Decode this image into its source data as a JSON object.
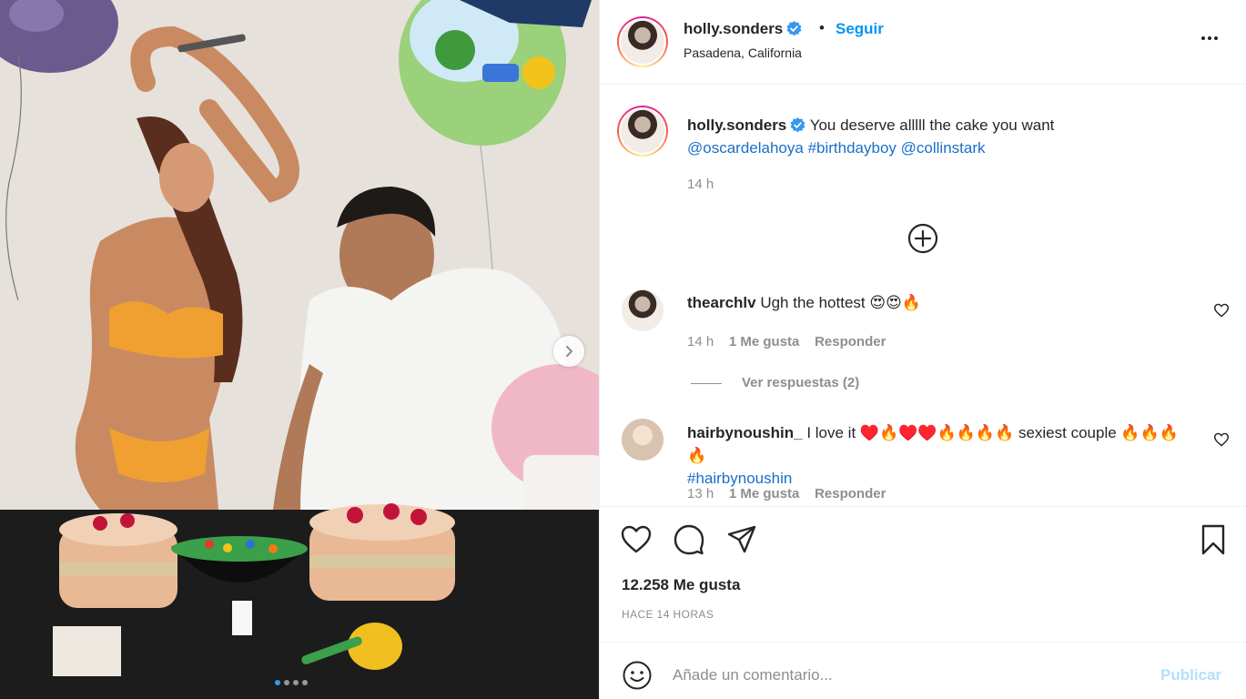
{
  "post": {
    "image_alt": "",
    "carousel": {
      "total": 4,
      "active_index": 0
    }
  },
  "header": {
    "username": "holly.sonders",
    "separator": "•",
    "follow_label": "Seguir",
    "location": "Pasadena, California",
    "more_icon": "ellipsis-icon"
  },
  "caption": {
    "username": "holly.sonders",
    "text": "You deserve alllll the cake you want",
    "tags": [
      "@oscardelahoya",
      "#birthdayboy",
      "@collinstark"
    ],
    "time": "14 h"
  },
  "comments": [
    {
      "username": "thearchlv",
      "text": "Ugh the hottest 😍😍🔥",
      "time": "14 h",
      "likes": "1 Me gusta",
      "reply_label": "Responder",
      "view_replies": "Ver respuestas (2)"
    },
    {
      "username": "hairbynoushin_",
      "text": "I love it ♥️🔥♥️♥️🔥🔥🔥🔥 sexiest couple 🔥🔥🔥🔥",
      "hashtag": "#hairbynoushin",
      "time": "13 h",
      "likes": "1 Me gusta",
      "reply_label": "Responder"
    }
  ],
  "actions": {
    "likes_count": "12.258 Me gusta",
    "time_ago": "HACE 14 HORAS"
  },
  "composer": {
    "placeholder": "Añade un comentario...",
    "publish_label": "Publicar"
  },
  "colors": {
    "link": "#1a6fc9",
    "follow": "#0095f6",
    "publish_disabled": "#b2dffc",
    "muted": "#8e8e8e"
  }
}
